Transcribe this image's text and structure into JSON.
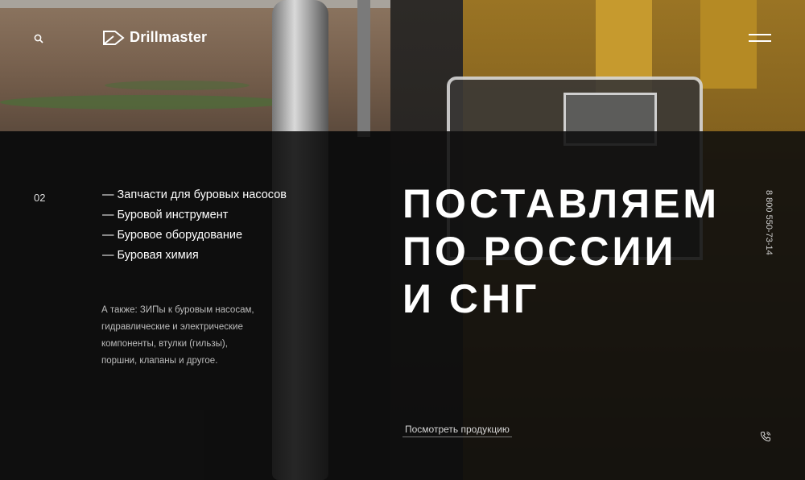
{
  "header": {
    "brand": "Drillmaster",
    "search_icon": "search-icon",
    "menu_icon": "hamburger-menu-icon"
  },
  "slide": {
    "number": "02"
  },
  "categories": [
    "— Запчасти для буровых насосов",
    "— Буровой инструмент",
    "— Буровое оборудование",
    "— Буровая химия"
  ],
  "also_text": "А также: ЗИПы к буровым насосам, гидравлические и электрические компоненты, втулки (гильзы), поршни, клапаны и другое.",
  "headline": {
    "line1": "Поставляем",
    "line2": "по России",
    "line3": "и СНГ"
  },
  "cta_label": "Посмотреть продукцию",
  "phone": "8 800 550-73-14",
  "phone_icon": "phone-icon",
  "colors": {
    "overlay": "#0e0e0e",
    "text": "#ffffff",
    "muted": "#bcbcbc",
    "machine_yellow": "#c69a2e"
  }
}
